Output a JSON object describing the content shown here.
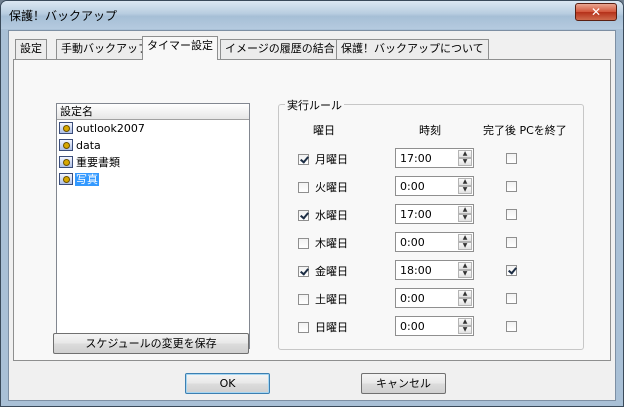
{
  "window": {
    "title": "保護！バックアップ",
    "close_label": "✕"
  },
  "tabs": [
    {
      "label": "設定"
    },
    {
      "label": "手動バックアップ"
    },
    {
      "label": "タイマー設定"
    },
    {
      "label": "イメージの履歴の結合"
    },
    {
      "label": "保護！バックアップについて"
    }
  ],
  "active_tab": "タイマー設定",
  "setting_list": {
    "header": "設定名",
    "items": [
      "outlook2007",
      "data",
      "重要書類",
      "写真"
    ],
    "selected": "写真"
  },
  "schedule": {
    "group_title": "実行ルール",
    "col_day": "曜日",
    "col_time": "時刻",
    "col_shutdown": "完了後 PCを終了",
    "rows": [
      {
        "day": "月曜日",
        "enabled": true,
        "time": "17:00",
        "shutdown": false
      },
      {
        "day": "火曜日",
        "enabled": false,
        "time": "0:00",
        "shutdown": false
      },
      {
        "day": "水曜日",
        "enabled": true,
        "time": "17:00",
        "shutdown": false
      },
      {
        "day": "木曜日",
        "enabled": false,
        "time": "0:00",
        "shutdown": false
      },
      {
        "day": "金曜日",
        "enabled": true,
        "time": "18:00",
        "shutdown": true
      },
      {
        "day": "土曜日",
        "enabled": false,
        "time": "0:00",
        "shutdown": false
      },
      {
        "day": "日曜日",
        "enabled": false,
        "time": "0:00",
        "shutdown": false
      }
    ]
  },
  "buttons": {
    "save_schedule": "スケジュールの変更を保存",
    "ok": "OK",
    "cancel": "キャンセル"
  },
  "colors": {
    "selection": "#3399ff",
    "title_close": "#c8432a"
  }
}
